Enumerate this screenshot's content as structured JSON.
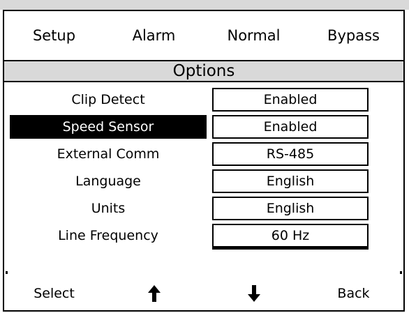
{
  "tabs": [
    "Setup",
    "Alarm",
    "Normal",
    "Bypass"
  ],
  "title": "Options",
  "rows": [
    {
      "label": "Clip Detect",
      "value": "Enabled"
    },
    {
      "label": "Speed Sensor",
      "value": "Enabled"
    },
    {
      "label": "External Comm",
      "value": "RS-485"
    },
    {
      "label": "Language",
      "value": "English"
    },
    {
      "label": "Units",
      "value": "English"
    },
    {
      "label": "Line Frequency",
      "value": "60 Hz"
    }
  ],
  "selected_row": "Speed Sensor",
  "softkeys": {
    "select": "Select",
    "up_icon": "arrow-up-icon",
    "down_icon": "arrow-down-icon",
    "back": "Back"
  }
}
